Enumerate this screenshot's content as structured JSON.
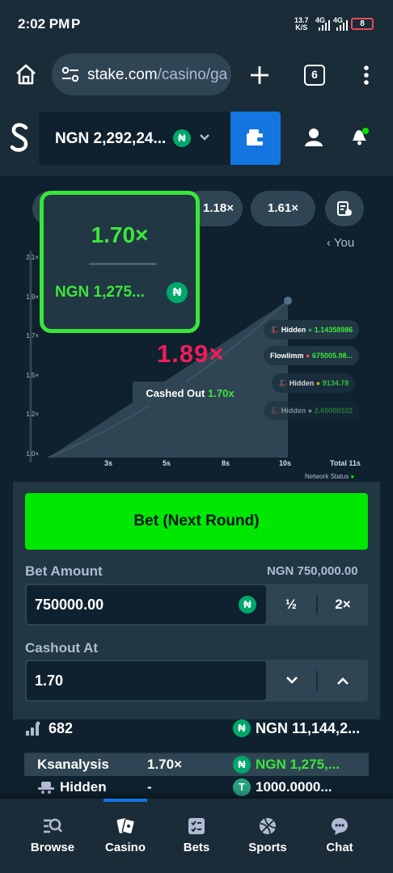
{
  "status_bar": {
    "time": "2:02 PM",
    "notification_icon": "P",
    "data_rate_top": "13.7",
    "data_rate_unit": "K/S",
    "net1": "4G",
    "net2": "4G",
    "battery": "8"
  },
  "browser": {
    "url_domain": "stake.com",
    "url_path": "/casino/ga",
    "tab_count": "6"
  },
  "header": {
    "balance": "NGN 2,292,24...",
    "currency_symbol": "₦"
  },
  "game": {
    "history": [
      "1.18×",
      "1.61×"
    ],
    "you_label": "You",
    "popup": {
      "multiplier": "1.70×",
      "win_amount": "NGN 1,275...",
      "currency_symbol": "₦"
    },
    "y_ticks": [
      "2.1×",
      "1.9×",
      "1.7×",
      "1.5×",
      "1.2×",
      "1.0×"
    ],
    "x_ticks": [
      "3s",
      "5s",
      "8s",
      "10s"
    ],
    "total": "Total 11s",
    "network_status": "Network Status",
    "current_multiplier": "1.89×",
    "cashed_out_label": "Cashed Out",
    "cashed_out_value": "1.70x",
    "players": [
      {
        "name": "Hidden",
        "amount": "1.14358986",
        "color": "#3de53d"
      },
      {
        "name": "Flowlimm",
        "amount": "675005.98...",
        "color": "#3de53d"
      },
      {
        "name": "Hidden",
        "amount": "9134.78",
        "color": "#3de53d"
      },
      {
        "name": "Hidden",
        "amount": "2.60000102",
        "color": "#3de53d"
      }
    ]
  },
  "bet": {
    "button_label": "Bet (Next Round)",
    "amount_label": "Bet Amount",
    "amount_value_display": "NGN 750,000.00",
    "amount_input": "750000.00",
    "half_label": "½",
    "double_label": "2×",
    "cashout_label": "Cashout At",
    "cashout_input": "1.70"
  },
  "stats": {
    "players_count": "682",
    "total_bet": "NGN 11,144,2..."
  },
  "bets_list": [
    {
      "user": "Ksanalysis",
      "multiplier": "1.70×",
      "amount": "NGN 1,275,...",
      "amount_color": "#3de53d",
      "coin": "₦"
    },
    {
      "user": "Hidden",
      "multiplier": "-",
      "amount": "1000.0000...",
      "amount_color": "#ffffff",
      "coin": "T"
    }
  ],
  "bottom_nav": [
    {
      "label": "Browse",
      "icon": "browse-icon"
    },
    {
      "label": "Casino",
      "icon": "casino-icon"
    },
    {
      "label": "Bets",
      "icon": "bets-icon"
    },
    {
      "label": "Sports",
      "icon": "sports-icon"
    },
    {
      "label": "Chat",
      "icon": "chat-icon"
    }
  ]
}
